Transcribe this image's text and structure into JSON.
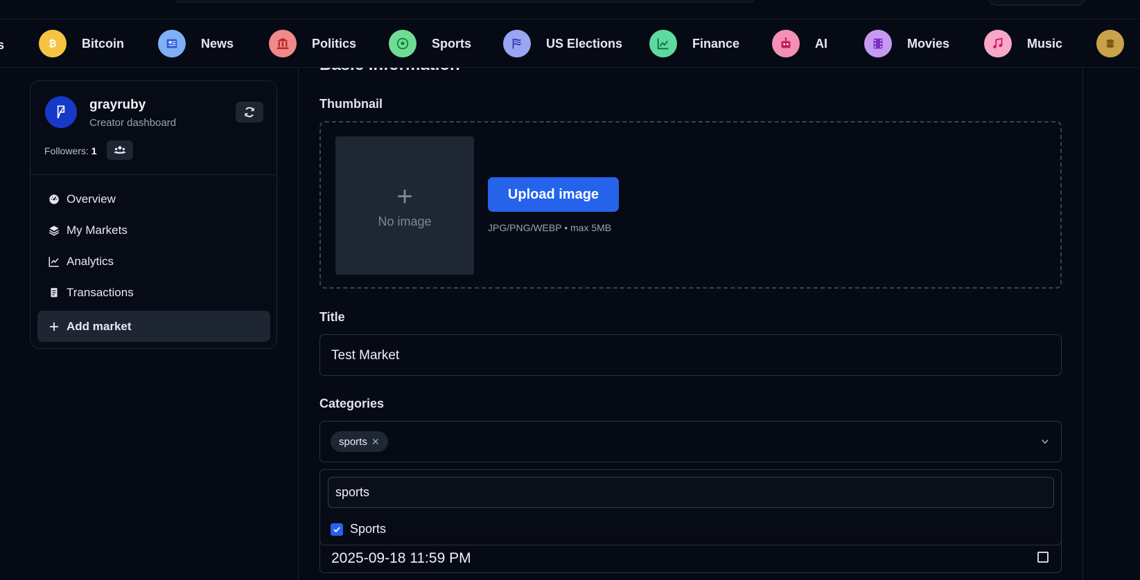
{
  "categories_bar": {
    "partial_left": "s",
    "items": [
      {
        "label": "Bitcoin",
        "icon": "bitcoin-icon",
        "color": "#f5c542"
      },
      {
        "label": "News",
        "icon": "newspaper-icon",
        "color": "#7fb0f5"
      },
      {
        "label": "Politics",
        "icon": "landmark-icon",
        "color": "#f08a8a"
      },
      {
        "label": "Sports",
        "icon": "soccer-ball-icon",
        "color": "#6fdc95"
      },
      {
        "label": "US Elections",
        "icon": "flag-icon",
        "color": "#9aa6f2"
      },
      {
        "label": "Finance",
        "icon": "chart-line-icon",
        "color": "#5edaa0"
      },
      {
        "label": "AI",
        "icon": "robot-icon",
        "color": "#f290b5"
      },
      {
        "label": "Movies",
        "icon": "film-icon",
        "color": "#c79af2"
      },
      {
        "label": "Music",
        "icon": "music-icon",
        "color": "#f7a8c8"
      }
    ]
  },
  "sidebar": {
    "username": "grayruby",
    "subtitle": "Creator dashboard",
    "followers_label": "Followers:",
    "followers_count": "1",
    "nav": [
      {
        "label": "Overview",
        "icon": "gauge-icon"
      },
      {
        "label": "My Markets",
        "icon": "layers-icon"
      },
      {
        "label": "Analytics",
        "icon": "chart-line-icon"
      },
      {
        "label": "Transactions",
        "icon": "receipt-icon"
      }
    ],
    "add_market": "Add market"
  },
  "form": {
    "section_title": "Basic Information",
    "thumbnail_label": "Thumbnail",
    "no_image": "No image",
    "upload_button": "Upload image",
    "upload_hint": "JPG/PNG/WEBP • max 5MB",
    "title_label": "Title",
    "title_value": "Test Market",
    "categories_label": "Categories",
    "selected_category": "sports",
    "category_search_value": "sports",
    "category_option": "Sports",
    "date_value": "2025-09-18 11:59 PM"
  },
  "colors": {
    "accent": "#2563eb",
    "background": "#060a14"
  }
}
